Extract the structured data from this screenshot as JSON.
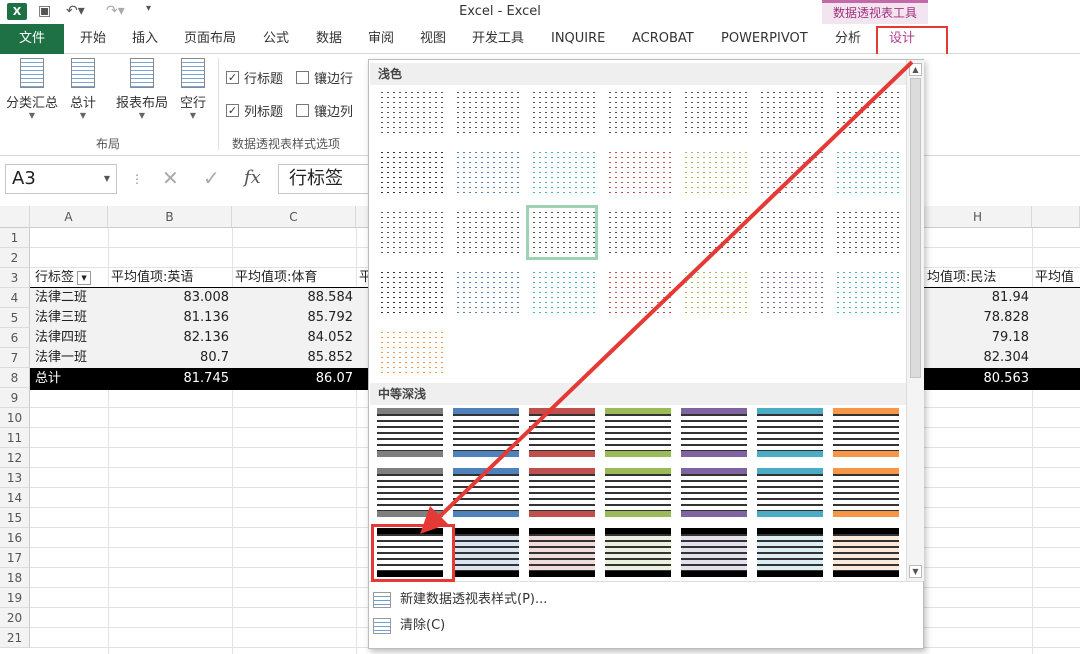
{
  "titlebar": {
    "title": "Excel - Excel",
    "context_tool": "数据透视表工具"
  },
  "tabs": [
    "文件",
    "开始",
    "插入",
    "页面布局",
    "公式",
    "数据",
    "审阅",
    "视图",
    "开发工具",
    "INQUIRE",
    "ACROBAT",
    "POWERPIVOT",
    "分析",
    "设计"
  ],
  "ribbon": {
    "buttons": [
      "分类汇总",
      "总计",
      "报表布局",
      "空行"
    ],
    "group_layout": "布局",
    "checks": [
      {
        "label": "行标题",
        "checked": true
      },
      {
        "label": "镶边行",
        "checked": false
      },
      {
        "label": "列标题",
        "checked": true
      },
      {
        "label": "镶边列",
        "checked": false
      }
    ],
    "group_options": "数据透视表样式选项",
    "check_mark": "✓"
  },
  "formula_bar": {
    "cell_ref": "A3",
    "fx_symbol": "fx",
    "content": "行标签"
  },
  "sheet": {
    "columns": [
      "A",
      "B",
      "C",
      "H"
    ],
    "rows": [
      "1",
      "2",
      "3",
      "4",
      "5",
      "6",
      "7",
      "8",
      "9",
      "10",
      "11",
      "12",
      "13",
      "14",
      "15",
      "16",
      "17",
      "18",
      "19",
      "20",
      "21"
    ],
    "header_row": [
      "行标签",
      "平均值项:英语",
      "平均值项:体育",
      "平",
      "均值项:民法",
      "平均值"
    ],
    "data": [
      {
        "name": "法律二班",
        "b": "83.008",
        "c": "88.584",
        "h": "81.94"
      },
      {
        "name": "法律三班",
        "b": "81.136",
        "c": "85.792",
        "h": "78.828"
      },
      {
        "name": "法律四班",
        "b": "82.136",
        "c": "84.052",
        "h": "79.18"
      },
      {
        "name": "法律一班",
        "b": "80.7",
        "c": "85.852",
        "h": "82.304"
      }
    ],
    "total": {
      "name": "总计",
      "b": "81.745",
      "c": "86.07",
      "h": "80.563"
    }
  },
  "gallery": {
    "section_light": "浅色",
    "section_medium": "中等深浅",
    "menu_new": "新建数据透视表样式(P)...",
    "menu_clear": "清除(C)",
    "light_colors": [
      "#333333",
      "#4f81bd",
      "#4bacc6",
      "#c0504d",
      "#9bbb59",
      "#8064a2",
      "#4bacc6"
    ],
    "medium_colors": [
      "#7f7f7f",
      "#4f81bd",
      "#c0504d",
      "#9bbb59",
      "#8064a2",
      "#4bacc6",
      "#f79646"
    ]
  },
  "colors": {
    "excel_green": "#1e7145",
    "context_pink": "#b03c8c",
    "highlight_red": "#e53935"
  }
}
